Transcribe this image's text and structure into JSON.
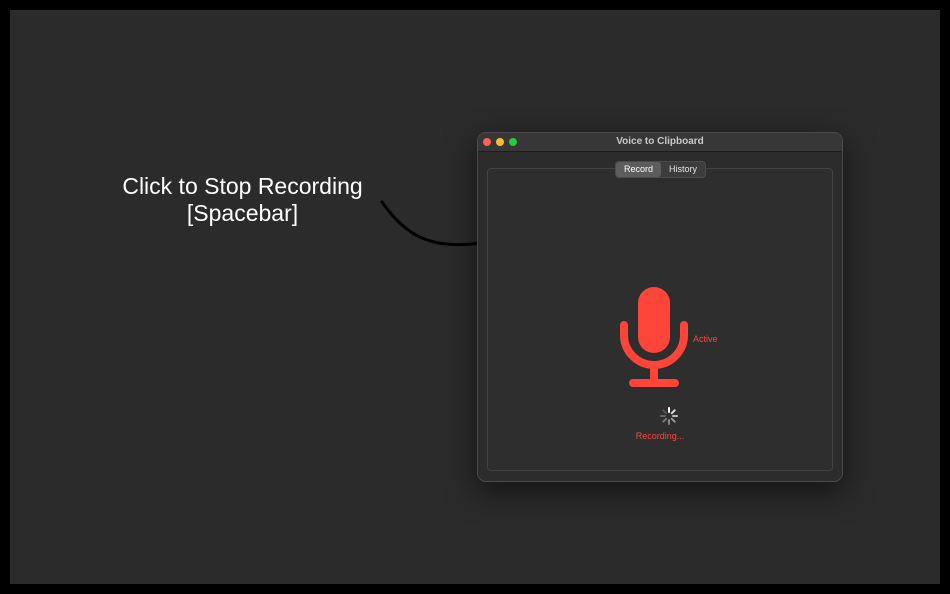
{
  "callout": {
    "line1": "Click to Stop Recording",
    "line2": "[Spacebar]"
  },
  "window": {
    "title": "Voice to Clipboard",
    "tabs": [
      {
        "label": "Record",
        "active": true
      },
      {
        "label": "History",
        "active": false
      }
    ],
    "mic_status": "Active",
    "recording_status": "Recording..."
  },
  "colors": {
    "accent_red": "#ff453a",
    "background": "#2b2b2b"
  }
}
